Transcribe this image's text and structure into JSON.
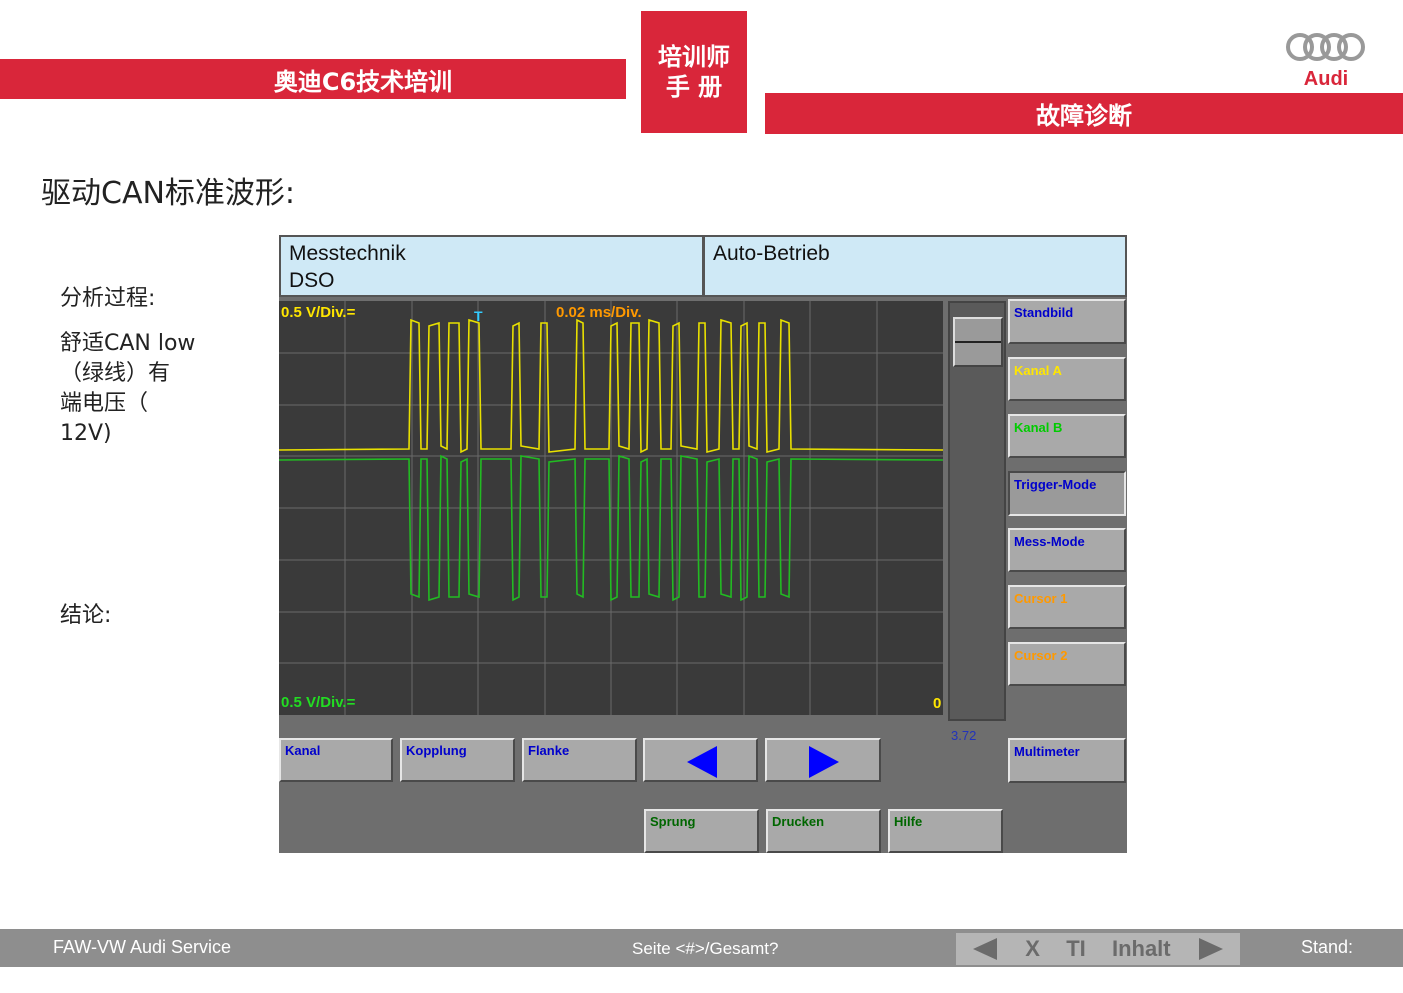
{
  "header": {
    "course_title": "奥迪C6技术培训",
    "badge_line1": "培训师",
    "badge_line2": "手 册",
    "section_title": "故障诊断",
    "brand_text": "Audi"
  },
  "slide": {
    "title": "驱动CAN标准波形:",
    "analysis_label": "分析过程:",
    "analysis_lines": [
      "舒适CAN low",
      "（绿线）有",
      "端电压（",
      "12V)"
    ],
    "conclusion_label": "结论:"
  },
  "dso": {
    "header_left_line1": "Messtechnik",
    "header_left_line2": "DSO",
    "header_right": "Auto-Betrieb",
    "ch_a_scale": "0.5 V/Div.=",
    "time_scale": "0.02 ms/Div.",
    "ch_b_scale": "0.5 V/Div.=",
    "zero_marker": "0",
    "trigger_marker": "T",
    "slider_value": "3.72",
    "side_buttons": [
      {
        "label": "Standbild",
        "color": "#0000cc"
      },
      {
        "label": "Kanal A",
        "color": "#ffe600"
      },
      {
        "label": "Kanal B",
        "color": "#00cc00"
      },
      {
        "label": "Trigger-Mode",
        "color": "#0000cc"
      },
      {
        "label": "Mess-Mode",
        "color": "#0000cc"
      },
      {
        "label": "Cursor 1",
        "color": "#ff9900"
      },
      {
        "label": "Cursor 2",
        "color": "#ff9900"
      }
    ],
    "multimeter_label": "Multimeter",
    "bottom_row1": [
      "Kanal",
      "Kopplung",
      "Flanke"
    ],
    "bottom_row2": [
      "Sprung",
      "Drucken",
      "Hilfe"
    ],
    "colors": {
      "channel_a": "#e8e000",
      "channel_b": "#22bb22",
      "header_bg": "#cfe9f6",
      "screen_bg": "#3a3a3a",
      "arrow": "#0000ff"
    }
  },
  "footer": {
    "left": "FAW-VW Audi Service",
    "center": "Seite <#>/Gesamt?",
    "nav_x": "X",
    "nav_ti": "TI",
    "nav_inhalt": "Inhalt",
    "right": "Stand:"
  }
}
